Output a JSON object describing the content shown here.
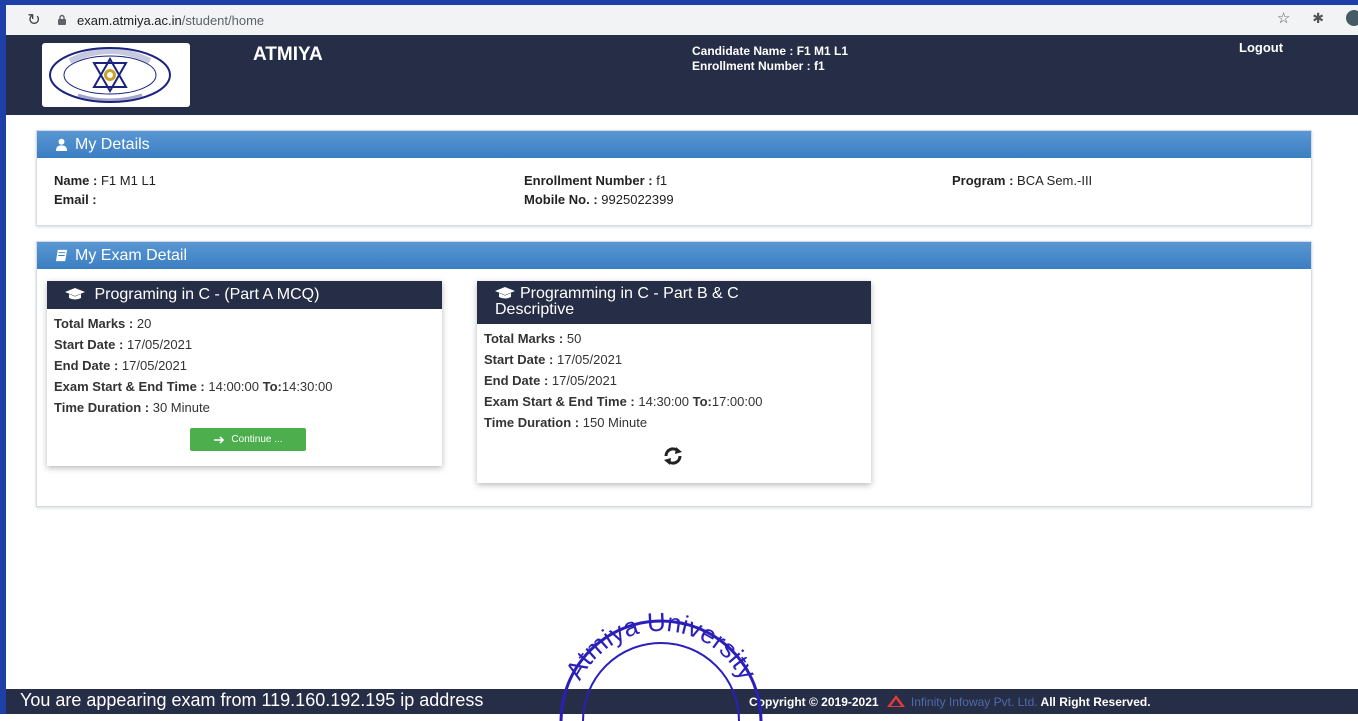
{
  "browser": {
    "url_host": "exam.atmiya.ac.in",
    "url_path": "/student/home",
    "reload_icon": "reload-icon",
    "star_icon": "star-icon",
    "extensions_icon": "puzzle-icon"
  },
  "header": {
    "app_title": "ATMIYA",
    "candidate_name": "Candidate Name : F1 M1 L1",
    "enrollment": "Enrollment Number : f1",
    "logout": "Logout",
    "logo_text": "ATMIYA UNIVERSITY",
    "bg_color": "#262e47"
  },
  "my_details": {
    "title": "My Details",
    "name_label": "Name :",
    "name_value": "F1 M1 L1",
    "email_label": "Email :",
    "email_value": "",
    "enroll_label": "Enrollment Number :",
    "enroll_value": "f1",
    "mobile_label": "Mobile No. :",
    "mobile_value": "9925022399",
    "program_label": "Program :",
    "program_value": "BCA Sem.-III"
  },
  "exam_detail": {
    "title": "My Exam Detail",
    "exams": [
      {
        "title": "Programing in C - (Part A MCQ)",
        "total_marks_label": "Total Marks :",
        "total_marks": "20",
        "start_date_label": "Start Date :",
        "start_date": "17/05/2021",
        "end_date_label": "End Date :",
        "end_date": "17/05/2021",
        "time_label": "Exam Start & End Time :",
        "start_time": "14:00:00",
        "to_label": "To:",
        "end_time": "14:30:00",
        "duration_label": "Time Duration :",
        "duration": "30 Minute",
        "action_label": "Continue ..."
      },
      {
        "title_line1": "Programming in C - Part B & C",
        "title_line2": "Descriptive",
        "total_marks_label": "Total Marks :",
        "total_marks": "50",
        "start_date_label": "Start Date :",
        "start_date": "17/05/2021",
        "end_date_label": "End Date :",
        "end_date": "17/05/2021",
        "time_label": "Exam Start & End Time :",
        "start_time": "14:30:00",
        "to_label": "To:",
        "end_time": "17:00:00",
        "duration_label": "Time Duration :",
        "duration": "150 Minute",
        "status_icon": "refresh-icon"
      }
    ]
  },
  "footer": {
    "ip_notice": "You are appearing exam from 119.160.192.195 ip address",
    "copyright": "Copyright © 2019-2021",
    "company": "Infinity Infoway Pvt. Ltd.",
    "rights": "All Right Reserved."
  },
  "stamp": {
    "text": "Atmiya University"
  },
  "colors": {
    "panel_header": "#3a7ec2",
    "continue_button": "#4cae4c",
    "browser_frame": "#1e3fa8"
  }
}
